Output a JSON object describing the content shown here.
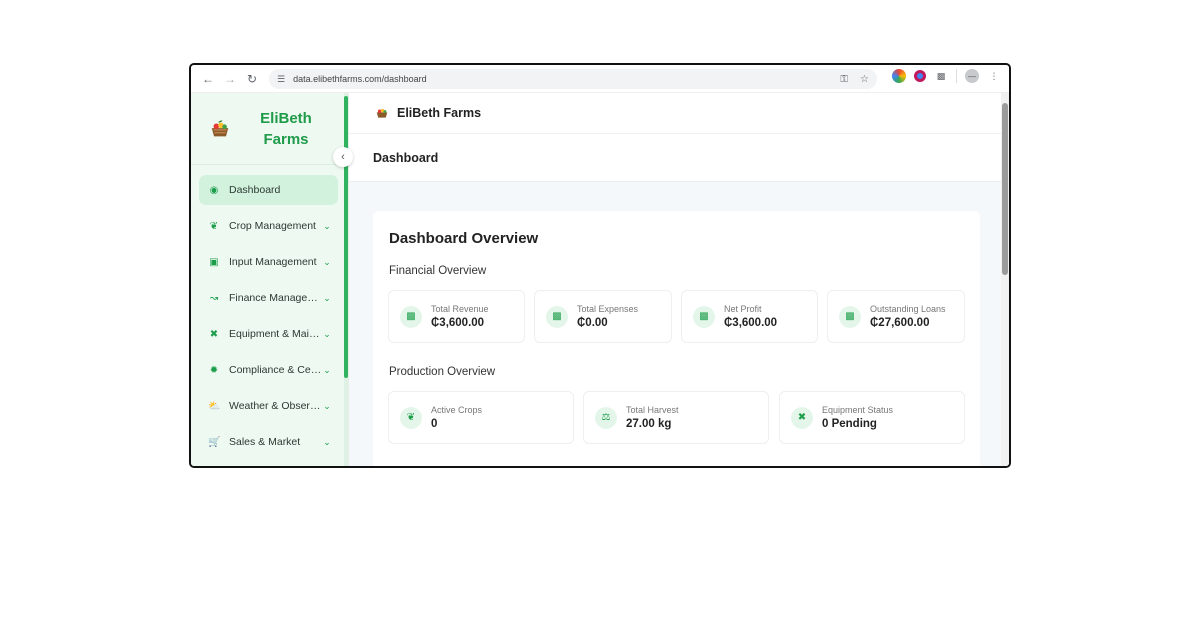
{
  "browser": {
    "url": "data.elibethfarms.com/dashboard"
  },
  "sidebar": {
    "brand_name": "EliBeth Farms",
    "items": [
      {
        "label": "Dashboard",
        "icon": "palette-icon",
        "active": true
      },
      {
        "label": "Crop Management",
        "icon": "sprout-icon",
        "chevron": true
      },
      {
        "label": "Input Management",
        "icon": "calendar-icon",
        "chevron": true
      },
      {
        "label": "Finance Manageme…",
        "icon": "chart-line-icon",
        "chevron": true
      },
      {
        "label": "Equipment & Maint…",
        "icon": "tools-icon",
        "chevron": true
      },
      {
        "label": "Compliance & Certi…",
        "icon": "badge-icon",
        "chevron": true
      },
      {
        "label": "Weather & Observa…",
        "icon": "weather-icon",
        "chevron": true
      },
      {
        "label": "Sales & Market",
        "icon": "cart-icon",
        "chevron": true
      }
    ]
  },
  "header": {
    "app_title": "EliBeth Farms",
    "page_title": "Dashboard"
  },
  "overview": {
    "title": "Dashboard Overview",
    "financial_title": "Financial Overview",
    "financial": [
      {
        "label": "Total Revenue",
        "value": "₵3,600.00",
        "icon": "cash-icon"
      },
      {
        "label": "Total Expenses",
        "value": "₵0.00",
        "icon": "cash-icon"
      },
      {
        "label": "Net Profit",
        "value": "₵3,600.00",
        "icon": "cash-icon"
      },
      {
        "label": "Outstanding Loans",
        "value": "₵27,600.00",
        "icon": "cash-icon"
      }
    ],
    "production_title": "Production Overview",
    "production": [
      {
        "label": "Active Crops",
        "value": "0",
        "icon": "sprout-icon"
      },
      {
        "label": "Total Harvest",
        "value": "27.00 kg",
        "icon": "scale-icon"
      },
      {
        "label": "Equipment Status",
        "value": "0 Pending",
        "icon": "tools-icon"
      }
    ]
  },
  "colors": {
    "accent": "#1f9b4a",
    "sidebar_bg": "#edf9f1",
    "active_bg": "#d3f2de"
  }
}
